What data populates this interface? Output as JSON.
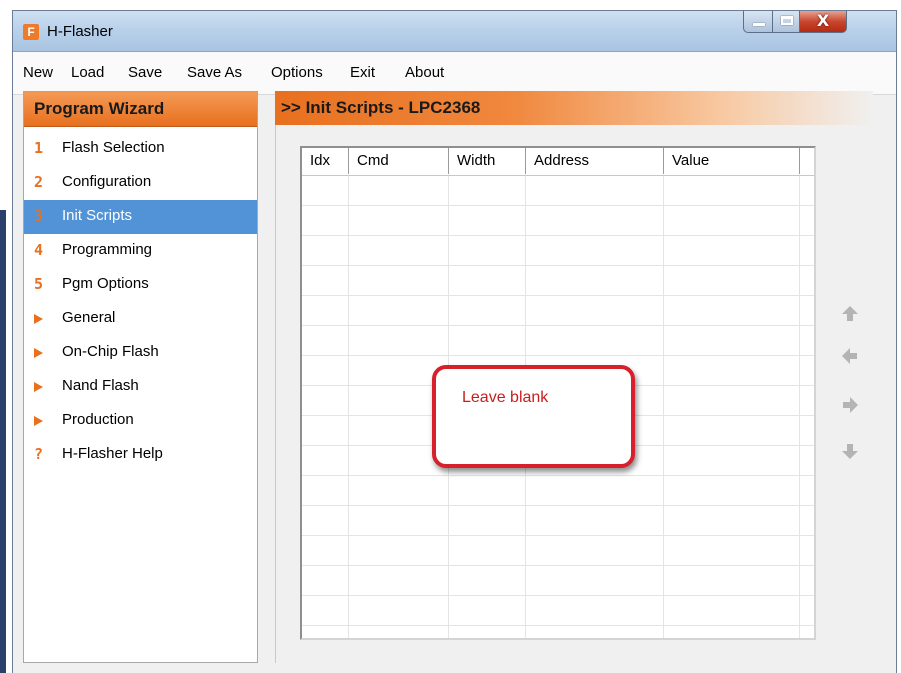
{
  "window": {
    "title": "H-Flasher",
    "app_icon_letter": "F",
    "close_glyph": "X"
  },
  "menu": {
    "items": [
      "New",
      "Load",
      "Save",
      "Save As",
      "Options",
      "Exit",
      "About"
    ]
  },
  "wizard": {
    "header": "Program Wizard",
    "items": [
      {
        "marker": "1",
        "label": "Flash Selection"
      },
      {
        "marker": "2",
        "label": "Configuration"
      },
      {
        "marker": "3",
        "label": "Init Scripts",
        "selected": true
      },
      {
        "marker": "4",
        "label": "Programming"
      },
      {
        "marker": "5",
        "label": "Pgm Options"
      },
      {
        "marker": "arrow",
        "label": "General"
      },
      {
        "marker": "arrow",
        "label": "On-Chip Flash"
      },
      {
        "marker": "arrow",
        "label": "Nand Flash"
      },
      {
        "marker": "arrow",
        "label": "Production"
      },
      {
        "marker": "?",
        "label": "H-Flasher Help"
      }
    ]
  },
  "content": {
    "header": ">> Init Scripts - LPC2368"
  },
  "grid": {
    "columns": [
      "Idx",
      "Cmd",
      "Width",
      "Address",
      "Value"
    ],
    "rows": []
  },
  "callout": {
    "text": "Leave blank"
  },
  "side_buttons": [
    "up-arrow-icon",
    "left-arrow-icon",
    "right-arrow-icon",
    "down-arrow-icon"
  ],
  "colors": {
    "accent_orange": "#e8701f",
    "selection_blue": "#5193d6",
    "callout_red": "#d8202c",
    "arrow_gray": "#b4b4b4"
  }
}
